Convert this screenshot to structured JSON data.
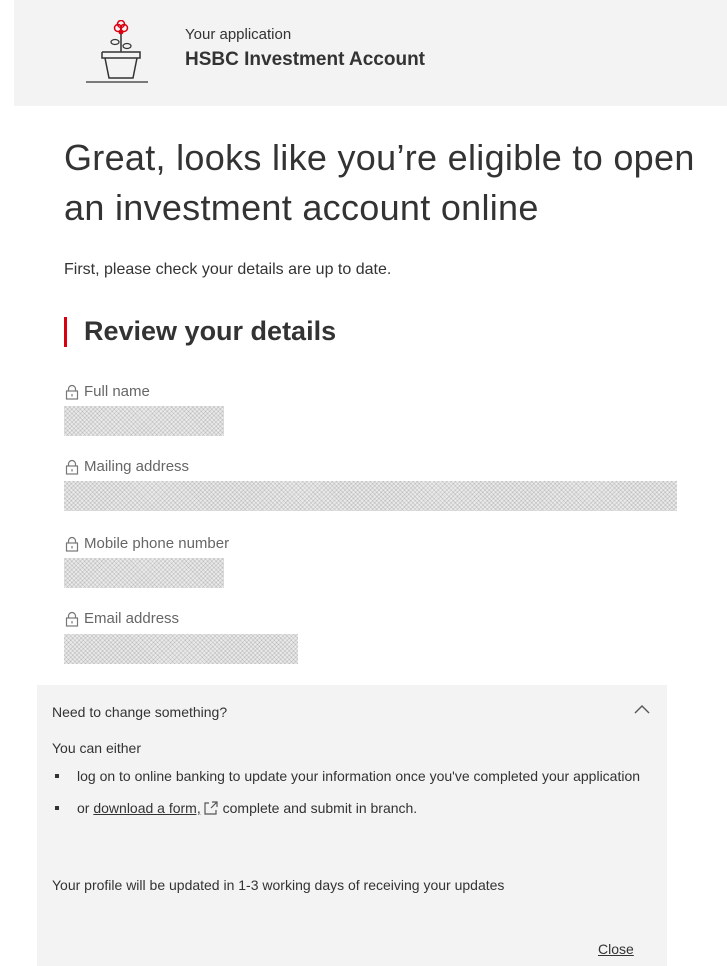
{
  "header": {
    "subtitle": "Your application",
    "title": "HSBC Investment Account",
    "icon": "plant-pot-icon"
  },
  "main": {
    "headline": "Great, looks like you’re eligible to open an investment account online",
    "intro": "First, please check your details are up to date.",
    "section_title": "Review your details",
    "accent_color": "#db0011",
    "fields": [
      {
        "label": "Full name",
        "value": ""
      },
      {
        "label": "Mailing address",
        "value": ""
      },
      {
        "label": "Mobile phone number",
        "value": ""
      },
      {
        "label": "Email address",
        "value": ""
      }
    ]
  },
  "panel": {
    "title": "Need to change something?",
    "lead": "You can either",
    "items": [
      {
        "text": "log on to online banking to update your information once you've completed your application"
      },
      {
        "prefix": "or ",
        "link": "download a form,",
        "suffix": " complete and submit in branch."
      }
    ],
    "note": "Your profile will be updated in 1-3 working days of receiving your updates",
    "close_label": "Close"
  }
}
